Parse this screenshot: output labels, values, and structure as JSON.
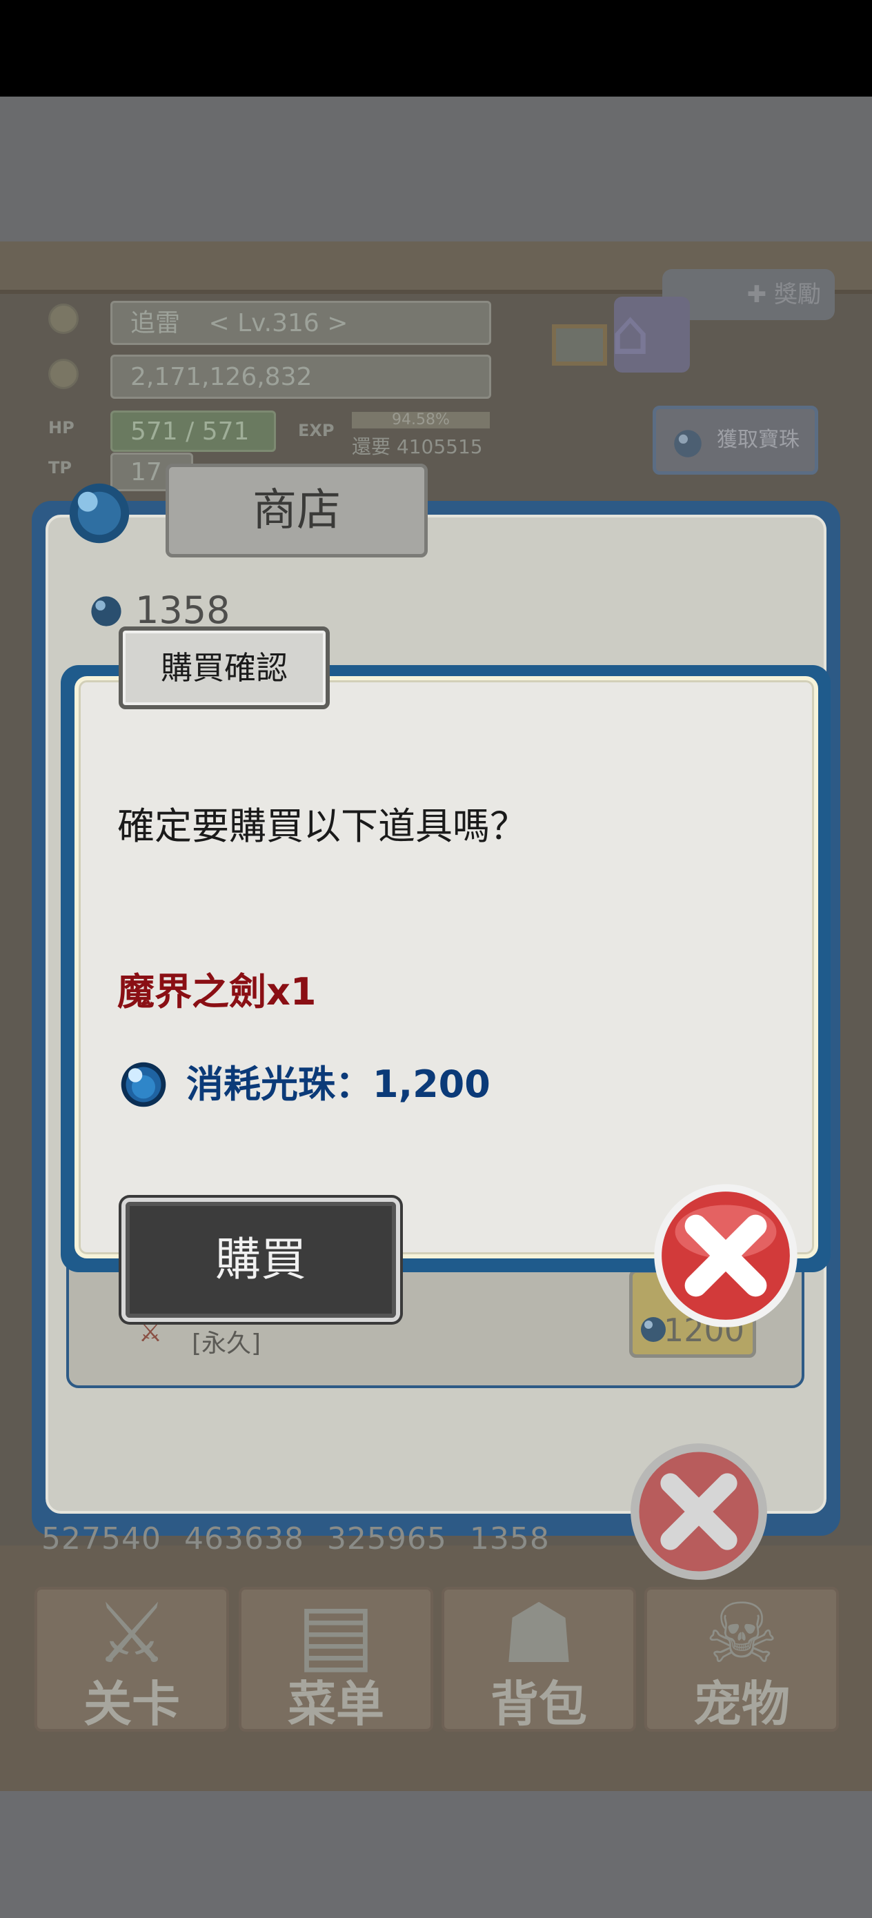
{
  "hud": {
    "player_name": "追雷",
    "player_level": "< Lv.316 >",
    "gold": "2,171,126,832",
    "hp_label": "HP",
    "hp": "571 / 571",
    "tp_label": "TP",
    "tp": "17",
    "exp_label": "EXP",
    "exp_percent": "94.58%",
    "exp_needed": "還要 4105515",
    "get_orb_button": "獲取寶珠",
    "top_right_label": "獎勵"
  },
  "shop": {
    "title": "商店",
    "orb_count": "1358",
    "item_subtitle": "[永久]",
    "item_price": "1200",
    "resources": [
      "527540",
      "463638",
      "325965",
      "1358"
    ]
  },
  "nav": {
    "items": [
      {
        "label": "关卡",
        "icon": "crossed-swords-icon"
      },
      {
        "label": "菜单",
        "icon": "book-icon"
      },
      {
        "label": "背包",
        "icon": "backpack-icon"
      },
      {
        "label": "宠物",
        "icon": "dragon-icon"
      }
    ]
  },
  "dialog": {
    "title": "購買確認",
    "question": "確定要購買以下道具嗎？",
    "item": "魔界之劍x1",
    "cost": "消耗光珠：1,200",
    "buy_label": "購買"
  },
  "colors": {
    "dialog_border": "#1f5b8c",
    "item_name": "#8a0f14",
    "cost_text": "#0b3a78",
    "buy_button": "#3c3c3c",
    "close_button": "#d23a3a"
  }
}
